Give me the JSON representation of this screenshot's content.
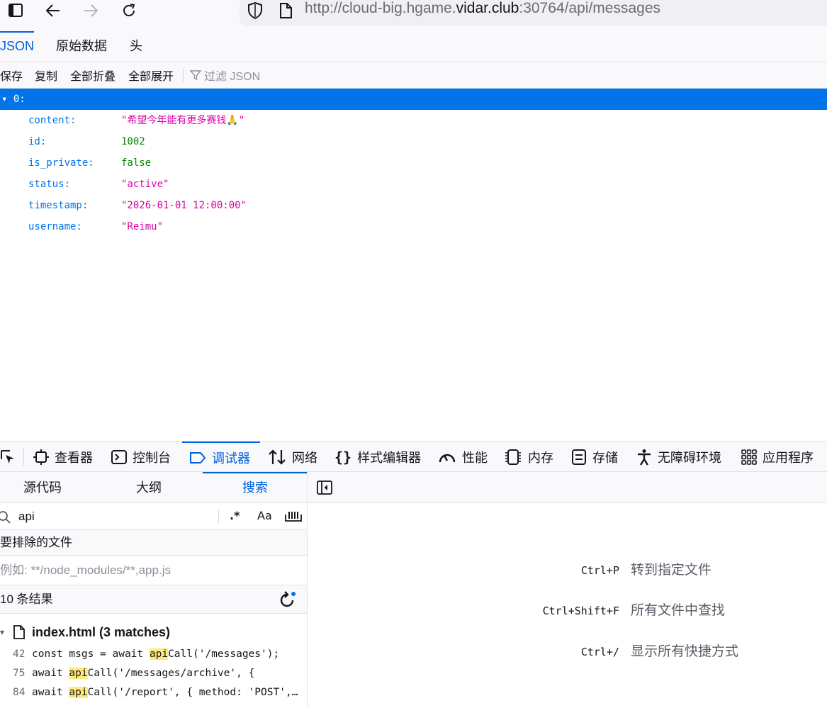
{
  "browser": {
    "url_prefix": "http://cloud-big.hgame.",
    "url_host": "vidar.club",
    "url_suffix": ":30764/api/messages"
  },
  "json_viewer": {
    "tabs": [
      "JSON",
      "原始数据",
      "头"
    ],
    "toolbar": {
      "save": "保存",
      "copy": "复制",
      "collapse_all": "全部折叠",
      "expand_all": "全部展开",
      "filter_placeholder": "过滤 JSON"
    },
    "root_label": "0:",
    "rows": [
      {
        "key": "content:",
        "value": "\"希望今年能有更多赛钱🙏\"",
        "type": "str"
      },
      {
        "key": "id:",
        "value": "1002",
        "type": "num"
      },
      {
        "key": "is_private:",
        "value": "false",
        "type": "bool"
      },
      {
        "key": "status:",
        "value": "\"active\"",
        "type": "str"
      },
      {
        "key": "timestamp:",
        "value": "\"2026-01-01 12:00:00\"",
        "type": "str"
      },
      {
        "key": "username:",
        "value": "\"Reimu\"",
        "type": "str"
      }
    ]
  },
  "devtools": {
    "tabs": {
      "inspector": "查看器",
      "console": "控制台",
      "debugger": "调试器",
      "network": "网络",
      "style_editor": "样式编辑器",
      "performance": "性能",
      "memory": "内存",
      "storage": "存储",
      "accessibility": "无障碍环境",
      "application": "应用程序"
    },
    "sub_tabs": {
      "sources": "源代码",
      "outline": "大纲",
      "search": "搜索"
    },
    "search": {
      "value": "api",
      "regex_label": ".*",
      "case_label": "Aa"
    },
    "exclude_label": "要排除的文件",
    "exclude_placeholder": "例如: **/node_modules/**,app.js",
    "result_count": "10 条结果",
    "file": {
      "name": "index.html (3 matches)",
      "matches": [
        {
          "line": "42",
          "before": "const msgs = await ",
          "hit": "api",
          "after": "Call('/messages');"
        },
        {
          "line": "75",
          "before": "await ",
          "hit": "api",
          "after": "Call('/messages/archive', {"
        },
        {
          "line": "84",
          "before": "await ",
          "hit": "api",
          "after": "Call('/report', { method: 'POST', headers: { 'Content-Type': 'application/json' } });"
        }
      ]
    },
    "shortcuts": {
      "open_file_key": "Ctrl+P",
      "open_file_desc": "转到指定文件",
      "find_all_key": "Ctrl+Shift+F",
      "find_all_desc": "所有文件中查找",
      "show_all_key": "Ctrl+/",
      "show_all_desc": "显示所有快捷方式"
    }
  }
}
